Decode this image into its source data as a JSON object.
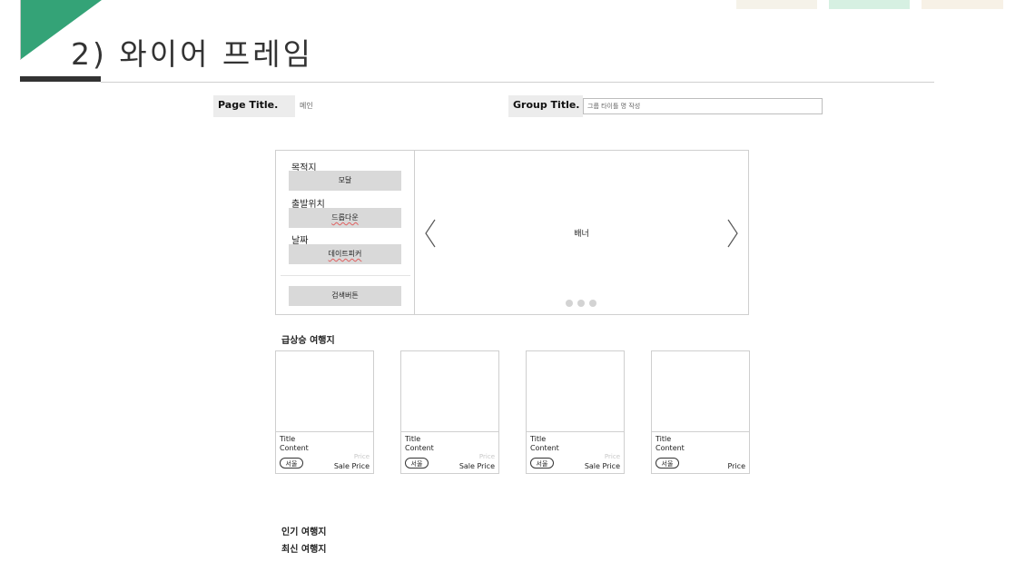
{
  "slide": {
    "title": "2) 와이어 프레임"
  },
  "colors": {
    "accent": "#34a377",
    "dark_bar": "#333333",
    "tab_1": "#f5f2e9",
    "tab_2": "#d6f0e2",
    "tab_3": "#f7f1e6"
  },
  "header": {
    "page_title_label": "Page Title.",
    "page_title_value": "메인",
    "group_title_label": "Group Title.",
    "group_title_placeholder": "그룹 타이틀 명 작성"
  },
  "search_panel": {
    "fields": [
      {
        "label": "목적지",
        "control": "모달"
      },
      {
        "label": "출발위치",
        "control": "드롭다운"
      },
      {
        "label": "날짜",
        "control": "데이트피커"
      }
    ],
    "search_button": "검색버튼"
  },
  "banner": {
    "text": "배너",
    "dots": 3
  },
  "sections": {
    "trending": "급상승 여행지",
    "popular": "인기 여행지",
    "recent": "최신 여행지"
  },
  "cards": [
    {
      "title": "Title",
      "content": "Content",
      "tag": "서울",
      "price": "Price",
      "sale": "Sale Price"
    },
    {
      "title": "Title",
      "content": "Content",
      "tag": "서울",
      "price": "Price",
      "sale": "Sale Price"
    },
    {
      "title": "Title",
      "content": "Content",
      "tag": "서울",
      "price": "Price",
      "sale": "Sale Price"
    },
    {
      "title": "Title",
      "content": "Content",
      "tag": "서울",
      "price": "",
      "sale": "Price"
    }
  ]
}
